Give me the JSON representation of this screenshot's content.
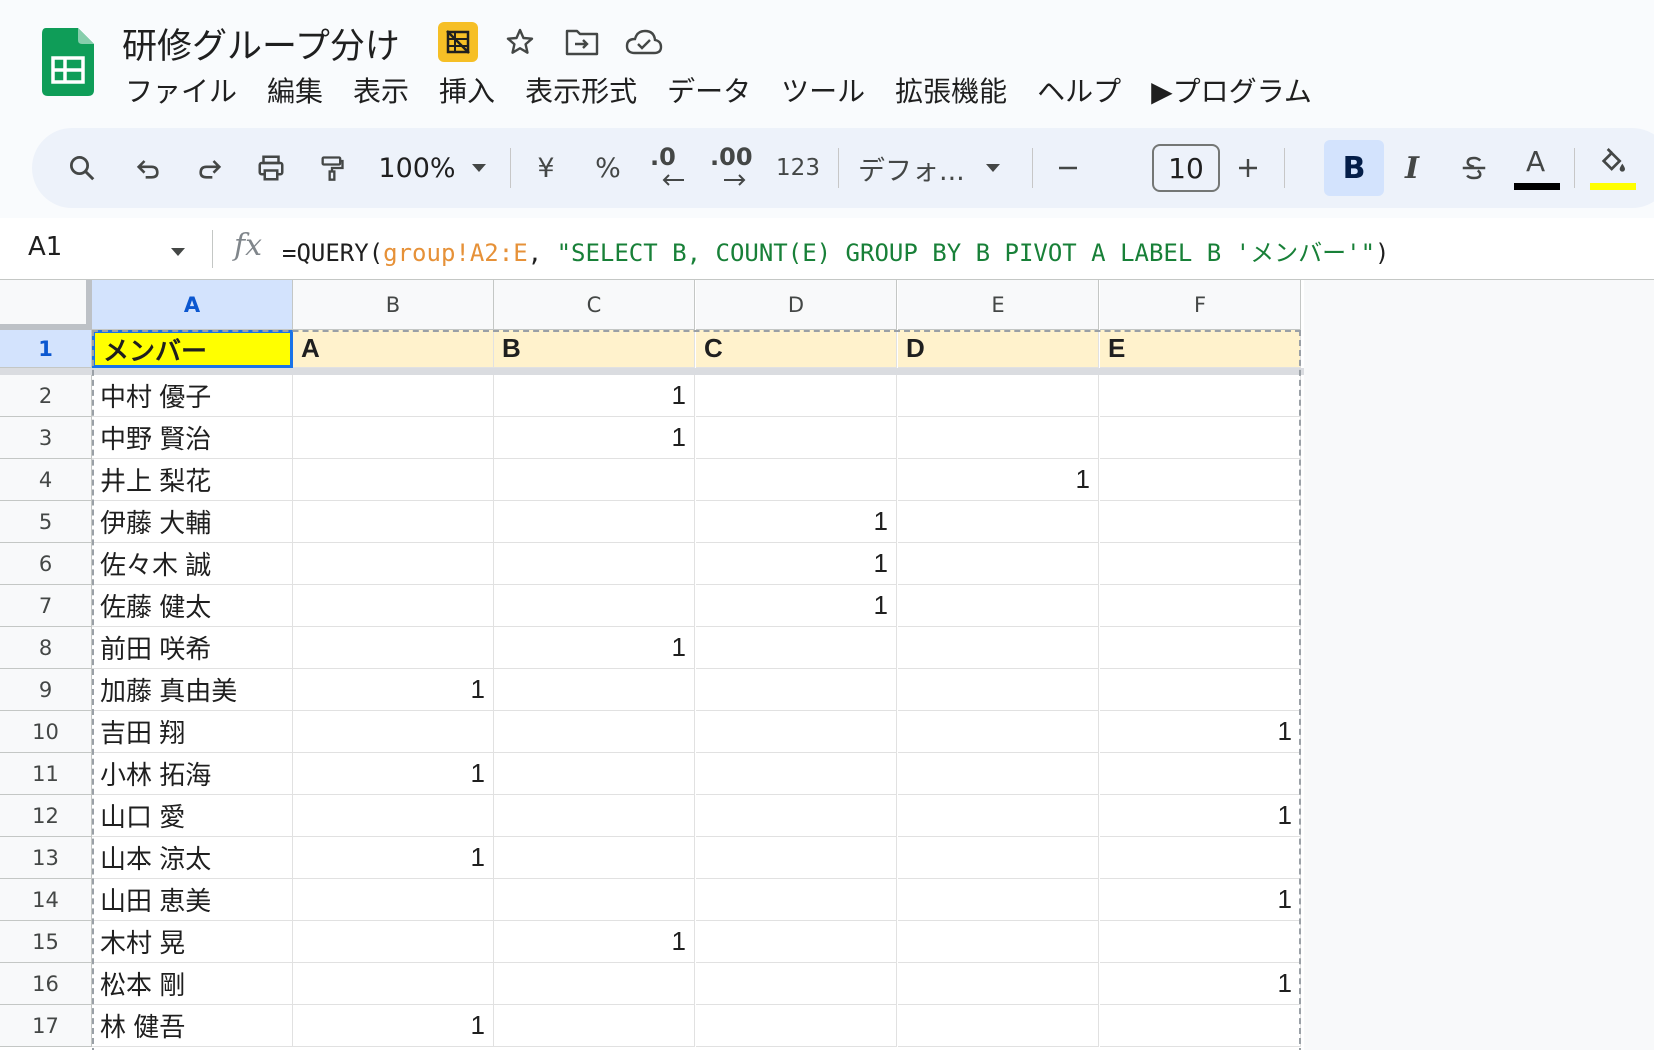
{
  "app": {
    "title": "研修グループ分け",
    "brand_color": "#0f9d58",
    "accent": "#0b57d0"
  },
  "title_icons": [
    "hide-gridlines-icon",
    "star-icon",
    "move-folder-icon",
    "cloud-saved-icon"
  ],
  "menu": [
    "ファイル",
    "編集",
    "表示",
    "挿入",
    "表示形式",
    "データ",
    "ツール",
    "拡張機能",
    "ヘルプ",
    "▶プログラム"
  ],
  "toolbar": {
    "zoom": "100%",
    "currency": "¥",
    "percent": "%",
    "dec_decrease": ".0",
    "dec_increase": ".00",
    "number_format": "123",
    "font": "デフォ...",
    "font_size": "10",
    "bold": "B",
    "italic": "I",
    "text_color_letter": "A"
  },
  "formula_bar": {
    "cell_ref": "A1",
    "fx": "fx",
    "formula_prefix": "=QUERY(",
    "formula_range": "group!A2:E",
    "formula_comma": ", ",
    "formula_string": "\"SELECT B, COUNT(E) GROUP BY B PIVOT A LABEL B 'メンバー'\"",
    "formula_suffix": ")"
  },
  "sheet": {
    "columns": [
      "A",
      "B",
      "C",
      "D",
      "E",
      "F"
    ],
    "header_row": [
      "メンバー",
      "A",
      "B",
      "C",
      "D",
      "E"
    ],
    "rows": [
      [
        "中村 優子",
        "",
        "1",
        "",
        "",
        ""
      ],
      [
        "中野 賢治",
        "",
        "1",
        "",
        "",
        ""
      ],
      [
        "井上 梨花",
        "",
        "",
        "",
        "1",
        ""
      ],
      [
        "伊藤 大輔",
        "",
        "",
        "1",
        "",
        ""
      ],
      [
        "佐々木 誠",
        "",
        "",
        "1",
        "",
        ""
      ],
      [
        "佐藤 健太",
        "",
        "",
        "1",
        "",
        ""
      ],
      [
        "前田 咲希",
        "",
        "1",
        "",
        "",
        ""
      ],
      [
        "加藤 真由美",
        "1",
        "",
        "",
        "",
        ""
      ],
      [
        "吉田 翔",
        "",
        "",
        "",
        "",
        "1"
      ],
      [
        "小林 拓海",
        "1",
        "",
        "",
        "",
        ""
      ],
      [
        "山口 愛",
        "",
        "",
        "",
        "",
        "1"
      ],
      [
        "山本 涼太",
        "1",
        "",
        "",
        "",
        ""
      ],
      [
        "山田 恵美",
        "",
        "",
        "",
        "",
        "1"
      ],
      [
        "木村 晃",
        "",
        "1",
        "",
        "",
        ""
      ],
      [
        "松本 剛",
        "",
        "",
        "",
        "",
        "1"
      ],
      [
        "林 健吾",
        "1",
        "",
        "",
        "",
        ""
      ]
    ]
  }
}
